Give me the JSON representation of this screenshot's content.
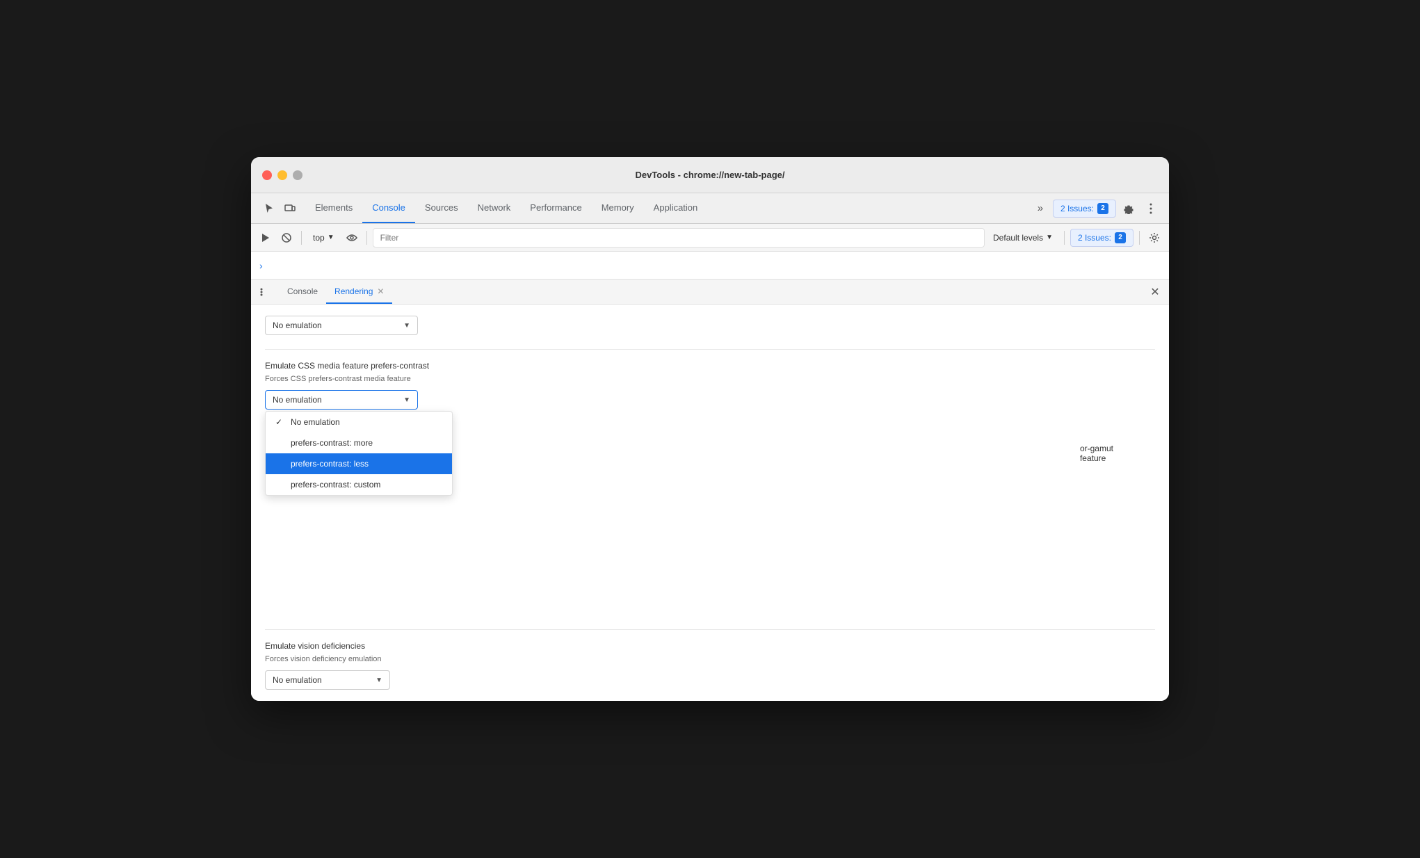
{
  "window": {
    "title": "DevTools - chrome://new-tab-page/"
  },
  "tabs": {
    "items": [
      {
        "label": "Elements",
        "active": false
      },
      {
        "label": "Console",
        "active": true
      },
      {
        "label": "Sources",
        "active": false
      },
      {
        "label": "Network",
        "active": false
      },
      {
        "label": "Performance",
        "active": false
      },
      {
        "label": "Memory",
        "active": false
      },
      {
        "label": "Application",
        "active": false
      }
    ],
    "more_label": "»",
    "issues_label": "2 Issues:",
    "issues_count": "2"
  },
  "console_toolbar": {
    "top_label": "top",
    "filter_placeholder": "Filter",
    "default_levels_label": "Default levels",
    "issues_label": "2 Issues:",
    "issues_count": "2"
  },
  "bottom_panel": {
    "tabs": [
      {
        "label": "Console",
        "active": false
      },
      {
        "label": "Rendering",
        "active": true,
        "closeable": true
      }
    ]
  },
  "rendering": {
    "section1": {
      "dropdown_value": "No emulation"
    },
    "section2": {
      "label": "Emulate CSS media feature prefers-contrast",
      "desc": "Forces CSS prefers-contrast media feature",
      "dropdown_value": "No emulation",
      "dropdown_options": [
        {
          "label": "No emulation",
          "checked": true,
          "selected": false
        },
        {
          "label": "prefers-contrast: more",
          "checked": false,
          "selected": false
        },
        {
          "label": "prefers-contrast: less",
          "checked": false,
          "selected": true
        },
        {
          "label": "prefers-contrast: custom",
          "checked": false,
          "selected": false
        }
      ]
    },
    "partial_text1": "or-gamut",
    "partial_text2": "feature",
    "section3": {
      "label": "Emulate vision deficiencies",
      "desc": "Forces vision deficiency emulation",
      "dropdown_value": "No emulation"
    }
  }
}
